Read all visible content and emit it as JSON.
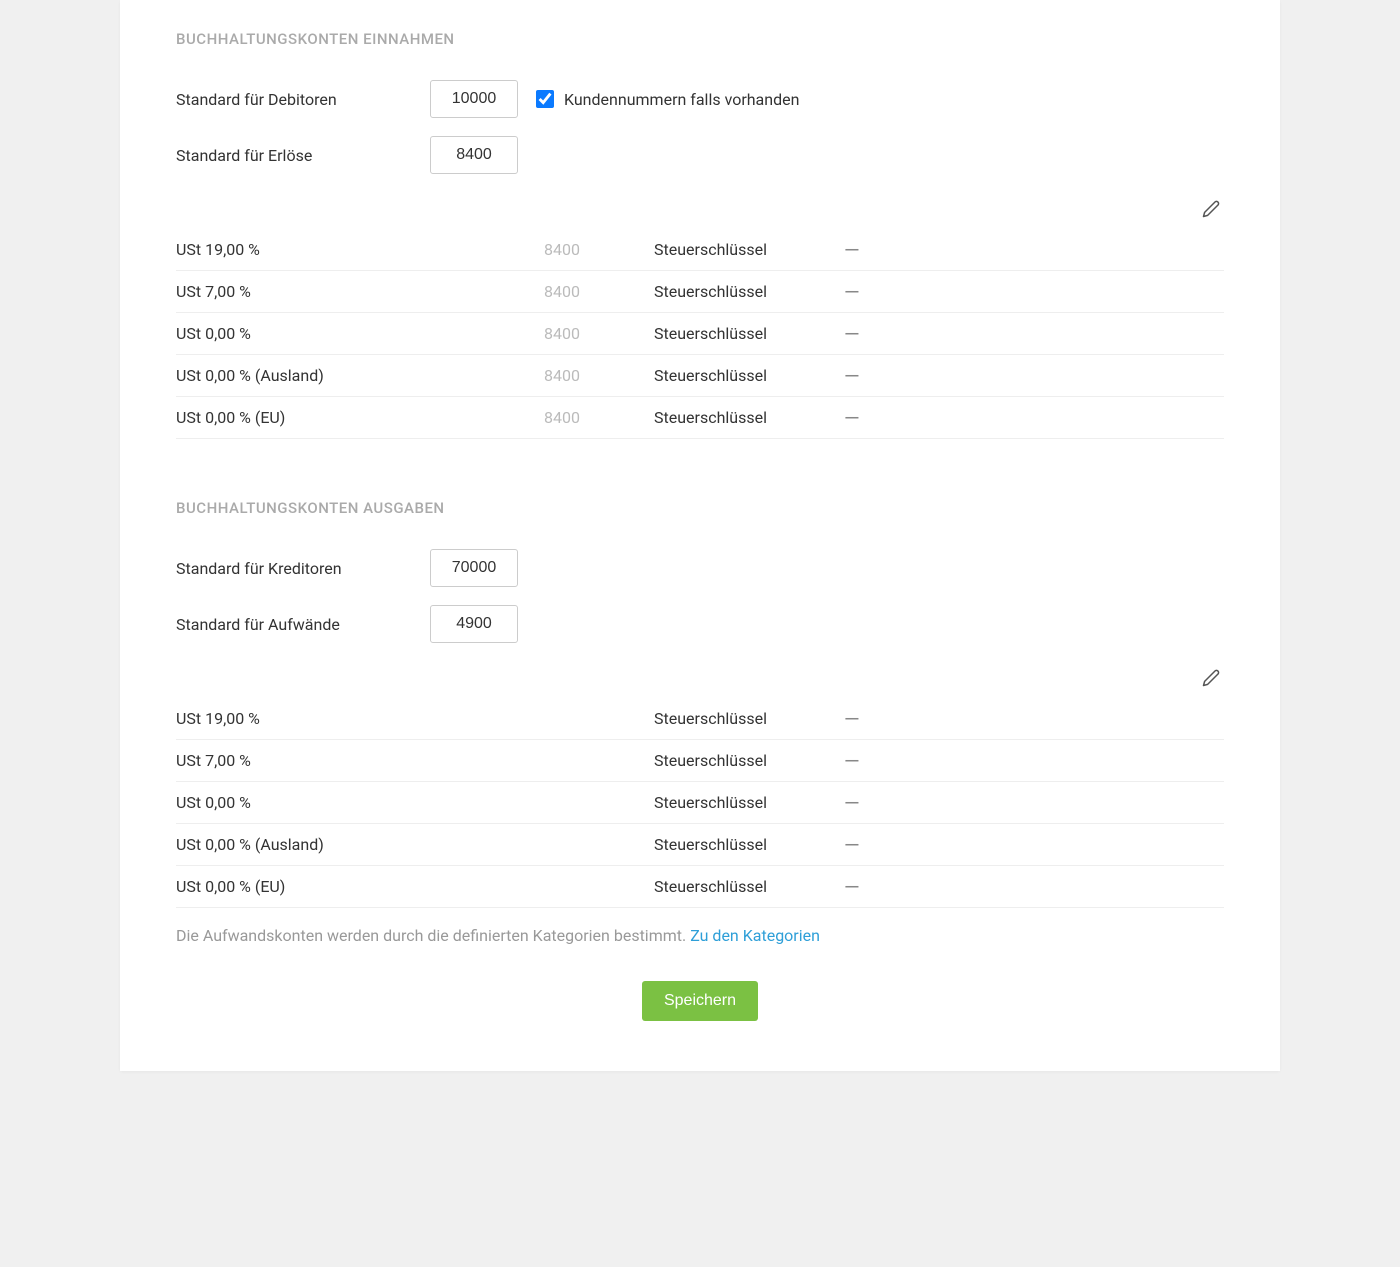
{
  "income": {
    "header": "BUCHHALTUNGSKONTEN EINNAHMEN",
    "debitors_label": "Standard für Debitoren",
    "debitors_value": "10000",
    "customer_numbers_label": "Kundennummern falls vorhanden",
    "customer_numbers_checked": true,
    "revenue_label": "Standard für Erlöse",
    "revenue_value": "8400",
    "rows": [
      {
        "label": "USt 19,00 %",
        "account": "8400",
        "key_label": "Steuerschlüssel",
        "key_value": "—"
      },
      {
        "label": "USt 7,00 %",
        "account": "8400",
        "key_label": "Steuerschlüssel",
        "key_value": "—"
      },
      {
        "label": "USt 0,00 %",
        "account": "8400",
        "key_label": "Steuerschlüssel",
        "key_value": "—"
      },
      {
        "label": "USt 0,00 % (Ausland)",
        "account": "8400",
        "key_label": "Steuerschlüssel",
        "key_value": "—"
      },
      {
        "label": "USt 0,00 % (EU)",
        "account": "8400",
        "key_label": "Steuerschlüssel",
        "key_value": "—"
      }
    ]
  },
  "expense": {
    "header": "BUCHHALTUNGSKONTEN AUSGABEN",
    "creditors_label": "Standard für Kreditoren",
    "creditors_value": "70000",
    "expenses_label": "Standard für Aufwände",
    "expenses_value": "4900",
    "rows": [
      {
        "label": "USt 19,00 %",
        "account": "",
        "key_label": "Steuerschlüssel",
        "key_value": "—"
      },
      {
        "label": "USt 7,00 %",
        "account": "",
        "key_label": "Steuerschlüssel",
        "key_value": "—"
      },
      {
        "label": "USt 0,00 %",
        "account": "",
        "key_label": "Steuerschlüssel",
        "key_value": "—"
      },
      {
        "label": "USt 0,00 % (Ausland)",
        "account": "",
        "key_label": "Steuerschlüssel",
        "key_value": "—"
      },
      {
        "label": "USt 0,00 % (EU)",
        "account": "",
        "key_label": "Steuerschlüssel",
        "key_value": "—"
      }
    ],
    "help_text": "Die Aufwandskonten werden durch die definierten Kategorien bestimmt. ",
    "help_link": "Zu den Kategorien"
  },
  "save_label": "Speichern"
}
